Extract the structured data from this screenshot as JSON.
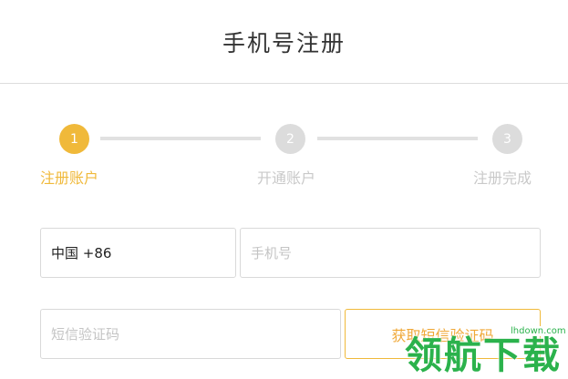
{
  "header": {
    "title": "手机号注册"
  },
  "stepper": {
    "steps": [
      {
        "number": "1",
        "label": "注册账户",
        "state": "active"
      },
      {
        "number": "2",
        "label": "开通账户",
        "state": "inactive"
      },
      {
        "number": "3",
        "label": "注册完成",
        "state": "inactive"
      }
    ],
    "colors": {
      "active": "#f0b93a",
      "active_label": "#f0b93a",
      "inactive": "#dcdcdc",
      "inactive_label": "#c9c9c9",
      "line": "#e1e1e1"
    }
  },
  "form": {
    "country_code": "中国 +86",
    "phone": {
      "value": "",
      "placeholder": "手机号"
    },
    "sms_code": {
      "value": "",
      "placeholder": "短信验证码"
    },
    "get_code_label": "获取短信验证码"
  },
  "watermark": {
    "text": "领航下载",
    "url": "lhdown.com"
  }
}
